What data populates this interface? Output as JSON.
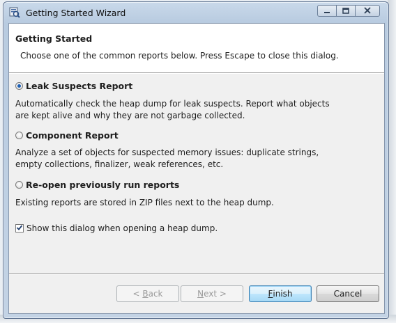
{
  "window": {
    "title": "Getting Started Wizard"
  },
  "header": {
    "title": "Getting Started",
    "description": "Choose one of the common reports below. Press Escape to close this dialog."
  },
  "options": [
    {
      "label": "Leak Suspects Report",
      "selected": true,
      "description_lines": [
        "Automatically check the heap dump for leak suspects. Report what objects",
        "are kept alive and why they are not garbage collected."
      ]
    },
    {
      "label": "Component Report",
      "selected": false,
      "description_lines": [
        "Analyze a set of objects for suspected memory issues: duplicate strings,",
        "empty collections, finalizer, weak references, etc."
      ]
    },
    {
      "label": "Re-open previously run reports",
      "selected": false,
      "description_lines": [
        "Existing reports are stored in ZIP files next to the heap dump."
      ]
    }
  ],
  "show_dialog_checkbox": {
    "label": "Show this dialog when opening a heap dump.",
    "checked": true
  },
  "buttons": {
    "back": {
      "prefix": "< ",
      "mnemonic": "B",
      "rest": "ack",
      "enabled": false
    },
    "next": {
      "mnemonic": "N",
      "rest": "ext >",
      "enabled": false
    },
    "finish": {
      "mnemonic": "F",
      "rest": "inish",
      "enabled": true,
      "default": true
    },
    "cancel": {
      "label": "Cancel",
      "enabled": true
    }
  },
  "icons": {
    "app": "mat-wizard-icon",
    "minimize": "minimize-icon",
    "maximize": "maximize-icon",
    "close": "close-icon"
  },
  "colors": {
    "selection_dot": "#1d5fb3",
    "default_button_border": "#3c7fb1"
  }
}
